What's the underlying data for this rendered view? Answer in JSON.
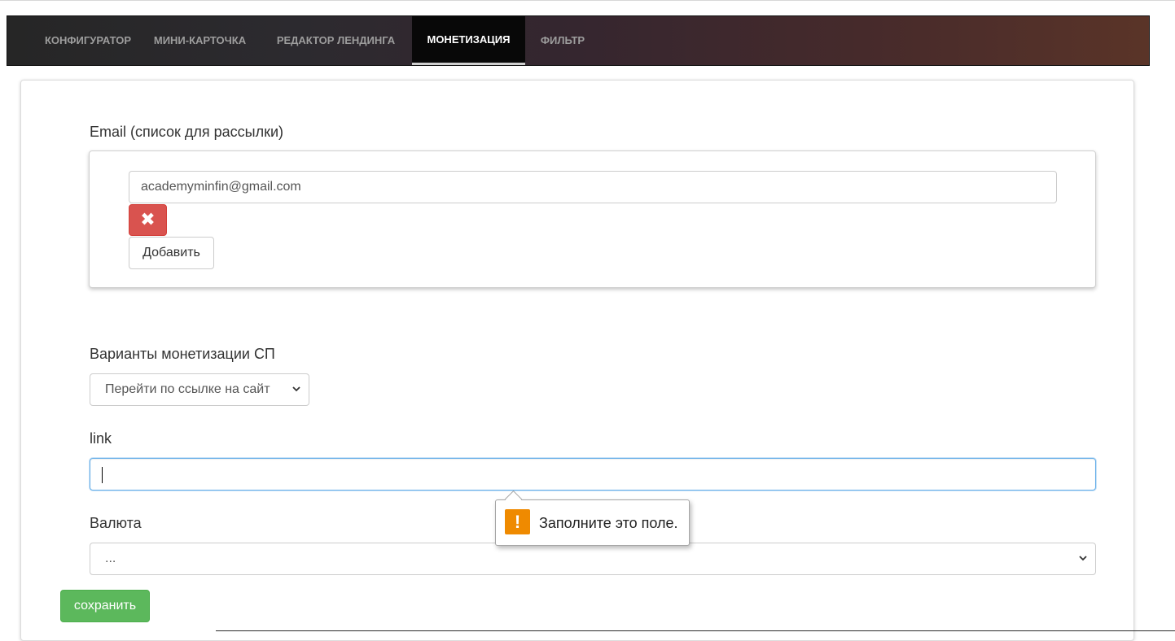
{
  "nav": {
    "tabs": [
      {
        "label": "КОНФИГУРАТОР",
        "active": false
      },
      {
        "label": "МИНИ-КАРТОЧКА",
        "active": false
      },
      {
        "label": "РЕДАКТОР ЛЕНДИНГА",
        "active": false
      },
      {
        "label": "МОНЕТИЗАЦИЯ",
        "active": true
      },
      {
        "label": "ФИЛЬТР",
        "active": false
      }
    ]
  },
  "email": {
    "label": "Email (список для рассылки)",
    "items": [
      {
        "value": "academyminfin@gmail.com"
      }
    ],
    "delete_icon": "x-icon",
    "add_label": "Добавить"
  },
  "monetization": {
    "label": "Варианты монетизации СП",
    "selected": "Перейти по ссылке на сайт"
  },
  "link": {
    "label": "link",
    "value": "",
    "tooltip": "Заполните это поле.",
    "tooltip_icon": "warning-icon"
  },
  "currency": {
    "label": "Валюта",
    "selected": "..."
  },
  "save_label": "сохранить",
  "colors": {
    "danger": "#d9534f",
    "success": "#5cb85c",
    "focus": "#66afe9",
    "warning": "#ef8a00"
  }
}
